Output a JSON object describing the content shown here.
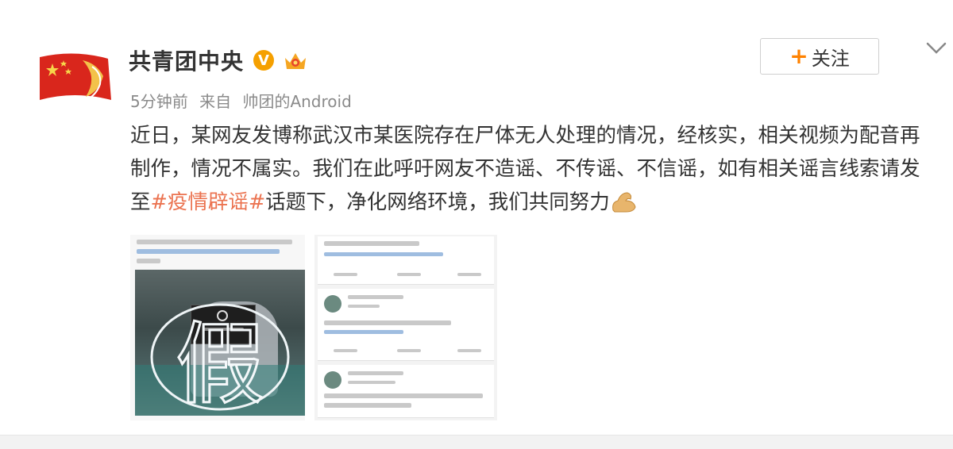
{
  "post": {
    "author": "共青团中央",
    "time": "5分钟前",
    "source_prefix": "来自",
    "source": "帅团的Android",
    "follow_label": "关注",
    "follow_plus": "+",
    "text_before_topic": "近日，某网友发博称武汉市某医院存在尸体无人处理的情况，经核实，相关视频为配音再制作，情况不属实。我们在此呼吁网友不造谣、不传谣、不信谣，如有相关谣言线索请发至",
    "topic": "#疫情辟谣#",
    "text_after_topic": "话题下，净化网络环境，我们共同努力",
    "verified_mark": "V"
  },
  "colors": {
    "topic": "#eb7350",
    "accent": "#ff8200",
    "name": "#333333",
    "meta": "#8a8a8a"
  },
  "icons": [
    "avatar-logo",
    "verified-icon",
    "vip-crown-icon",
    "chevron-down-icon",
    "flexed-biceps-icon",
    "fake-stamp-icon"
  ],
  "images": {
    "image1_stamp_text": "假"
  }
}
